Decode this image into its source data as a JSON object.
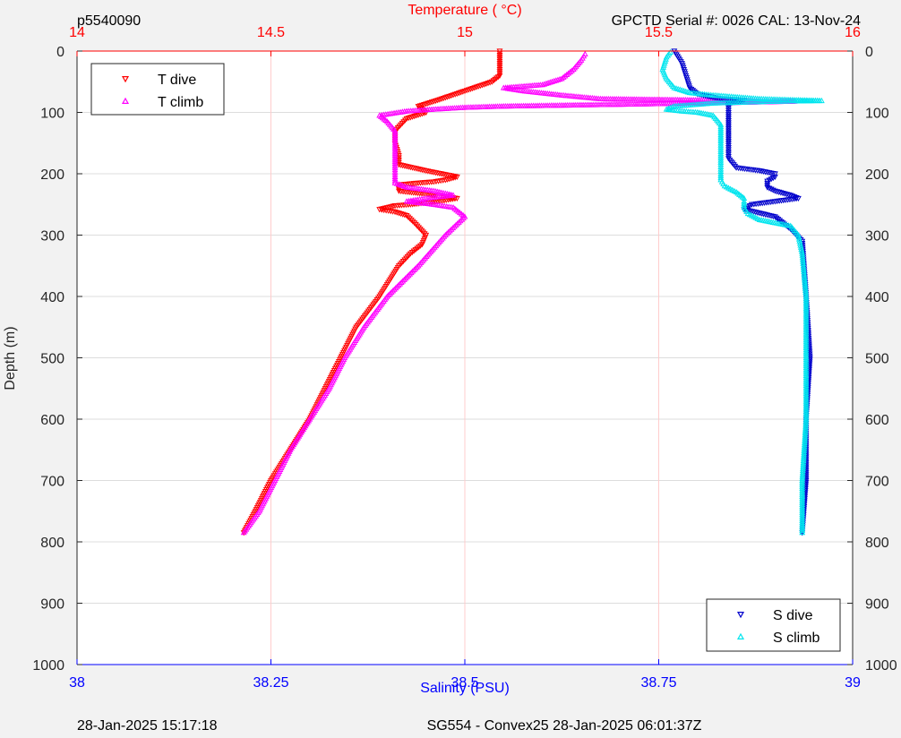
{
  "header": {
    "profile_id": "p5540090",
    "serial": "GPCTD Serial #: 0026 CAL: 13-Nov-24"
  },
  "footer": {
    "left": "28-Jan-2025 15:17:18",
    "center": "SG554 - Convex25 28-Jan-2025 06:01:37Z"
  },
  "colors": {
    "temperature_axis": "#ff0000",
    "salinity_axis": "#0000ff",
    "t_dive": "#ff0000",
    "t_climb": "#ff00ff",
    "s_dive": "#0000cc",
    "s_climb": "#00e5ee",
    "grid": "#dddddd",
    "temp_grid": "#ffcccc"
  },
  "chart_data": {
    "type": "scatter",
    "title": "",
    "y_axis": {
      "label": "Depth (m)",
      "range": [
        0,
        1000
      ],
      "reversed": true,
      "ticks": [
        "0",
        "100",
        "200",
        "300",
        "400",
        "500",
        "600",
        "700",
        "800",
        "900",
        "1000"
      ]
    },
    "top_axis": {
      "label": "Temperature (    °C)",
      "range": [
        14,
        16
      ],
      "ticks": [
        "14",
        "14.5",
        "15",
        "15.5",
        "16"
      ]
    },
    "bottom_axis": {
      "label": "Salinity (PSU)",
      "range": [
        38,
        39
      ],
      "ticks": [
        "38",
        "38.25",
        "38.5",
        "38.75",
        "39"
      ]
    },
    "grid": true,
    "legends": [
      {
        "position": "top-left",
        "entries": [
          {
            "label": "T dive",
            "marker": "triangle-down",
            "series": "T dive"
          },
          {
            "label": "T climb",
            "marker": "triangle-up",
            "series": "T climb"
          }
        ]
      },
      {
        "position": "bottom-right",
        "entries": [
          {
            "label": "S dive",
            "marker": "triangle-down",
            "series": "S dive"
          },
          {
            "label": "S climb",
            "marker": "triangle-up",
            "series": "S climb"
          }
        ]
      }
    ],
    "series": [
      {
        "name": "T dive",
        "axis": "temperature",
        "marker": "triangle-down",
        "points": [
          [
            15.09,
            0
          ],
          [
            15.09,
            40
          ],
          [
            15.07,
            50
          ],
          [
            15.0,
            65
          ],
          [
            14.93,
            80
          ],
          [
            14.88,
            90
          ],
          [
            14.9,
            100
          ],
          [
            14.85,
            110
          ],
          [
            14.82,
            130
          ],
          [
            14.82,
            150
          ],
          [
            14.83,
            170
          ],
          [
            14.83,
            185
          ],
          [
            14.9,
            195
          ],
          [
            14.98,
            205
          ],
          [
            14.95,
            210
          ],
          [
            14.92,
            213
          ],
          [
            14.88,
            215
          ],
          [
            14.83,
            218
          ],
          [
            14.83,
            228
          ],
          [
            14.9,
            233
          ],
          [
            14.98,
            240
          ],
          [
            14.93,
            245
          ],
          [
            14.86,
            250
          ],
          [
            14.82,
            252
          ],
          [
            14.78,
            258
          ],
          [
            14.82,
            262
          ],
          [
            14.85,
            268
          ],
          [
            14.87,
            280
          ],
          [
            14.9,
            300
          ],
          [
            14.89,
            315
          ],
          [
            14.86,
            330
          ],
          [
            14.83,
            350
          ],
          [
            14.78,
            400
          ],
          [
            14.72,
            450
          ],
          [
            14.68,
            500
          ],
          [
            14.64,
            550
          ],
          [
            14.6,
            600
          ],
          [
            14.55,
            650
          ],
          [
            14.5,
            700
          ],
          [
            14.46,
            750
          ],
          [
            14.43,
            785
          ]
        ]
      },
      {
        "name": "T climb",
        "axis": "temperature",
        "marker": "triangle-up",
        "points": [
          [
            14.43,
            785
          ],
          [
            14.47,
            750
          ],
          [
            14.51,
            700
          ],
          [
            14.55,
            650
          ],
          [
            14.6,
            600
          ],
          [
            14.65,
            550
          ],
          [
            14.69,
            500
          ],
          [
            14.74,
            450
          ],
          [
            14.8,
            400
          ],
          [
            14.88,
            350
          ],
          [
            14.95,
            300
          ],
          [
            15.0,
            270
          ],
          [
            14.97,
            255
          ],
          [
            14.92,
            250
          ],
          [
            14.85,
            245
          ],
          [
            14.9,
            240
          ],
          [
            14.97,
            235
          ],
          [
            14.92,
            228
          ],
          [
            14.85,
            222
          ],
          [
            14.82,
            215
          ],
          [
            14.82,
            205
          ],
          [
            14.82,
            190
          ],
          [
            14.82,
            170
          ],
          [
            14.82,
            150
          ],
          [
            14.82,
            130
          ],
          [
            14.8,
            115
          ],
          [
            14.78,
            105
          ],
          [
            14.85,
            98
          ],
          [
            14.92,
            95
          ],
          [
            15.0,
            92
          ],
          [
            15.1,
            90
          ],
          [
            15.3,
            88
          ],
          [
            15.5,
            86
          ],
          [
            15.7,
            84
          ],
          [
            15.85,
            82
          ],
          [
            15.6,
            80
          ],
          [
            15.35,
            78
          ],
          [
            15.25,
            72
          ],
          [
            15.15,
            65
          ],
          [
            15.1,
            60
          ],
          [
            15.2,
            55
          ],
          [
            15.25,
            45
          ],
          [
            15.28,
            30
          ],
          [
            15.3,
            15
          ],
          [
            15.31,
            5
          ]
        ]
      },
      {
        "name": "S dive",
        "axis": "salinity",
        "marker": "triangle-down",
        "points": [
          [
            38.77,
            0
          ],
          [
            38.78,
            20
          ],
          [
            38.785,
            40
          ],
          [
            38.79,
            60
          ],
          [
            38.8,
            70
          ],
          [
            38.83,
            78
          ],
          [
            38.86,
            80
          ],
          [
            38.84,
            85
          ],
          [
            38.84,
            100
          ],
          [
            38.84,
            120
          ],
          [
            38.84,
            150
          ],
          [
            38.84,
            175
          ],
          [
            38.85,
            190
          ],
          [
            38.88,
            195
          ],
          [
            38.9,
            200
          ],
          [
            38.9,
            205
          ],
          [
            38.89,
            212
          ],
          [
            38.89,
            222
          ],
          [
            38.9,
            228
          ],
          [
            38.92,
            235
          ],
          [
            38.93,
            240
          ],
          [
            38.9,
            245
          ],
          [
            38.87,
            250
          ],
          [
            38.86,
            258
          ],
          [
            38.9,
            270
          ],
          [
            38.92,
            290
          ],
          [
            38.935,
            310
          ],
          [
            38.94,
            400
          ],
          [
            38.945,
            500
          ],
          [
            38.94,
            600
          ],
          [
            38.94,
            700
          ],
          [
            38.935,
            785
          ]
        ]
      },
      {
        "name": "S climb",
        "axis": "salinity",
        "marker": "triangle-up",
        "points": [
          [
            38.935,
            785
          ],
          [
            38.935,
            700
          ],
          [
            38.94,
            600
          ],
          [
            38.94,
            500
          ],
          [
            38.94,
            400
          ],
          [
            38.935,
            330
          ],
          [
            38.93,
            300
          ],
          [
            38.92,
            285
          ],
          [
            38.9,
            280
          ],
          [
            38.88,
            275
          ],
          [
            38.865,
            265
          ],
          [
            38.86,
            255
          ],
          [
            38.86,
            245
          ],
          [
            38.86,
            240
          ],
          [
            38.85,
            230
          ],
          [
            38.835,
            220
          ],
          [
            38.83,
            210
          ],
          [
            38.83,
            200
          ],
          [
            38.83,
            185
          ],
          [
            38.83,
            150
          ],
          [
            38.83,
            120
          ],
          [
            38.82,
            105
          ],
          [
            38.8,
            100
          ],
          [
            38.78,
            98
          ],
          [
            38.76,
            95
          ],
          [
            38.77,
            90
          ],
          [
            38.82,
            85
          ],
          [
            38.9,
            82
          ],
          [
            38.96,
            81
          ],
          [
            38.93,
            80
          ],
          [
            38.88,
            78
          ],
          [
            38.82,
            72
          ],
          [
            38.79,
            68
          ],
          [
            38.77,
            60
          ],
          [
            38.76,
            45
          ],
          [
            38.755,
            30
          ],
          [
            38.76,
            10
          ],
          [
            38.765,
            2
          ]
        ]
      }
    ]
  }
}
